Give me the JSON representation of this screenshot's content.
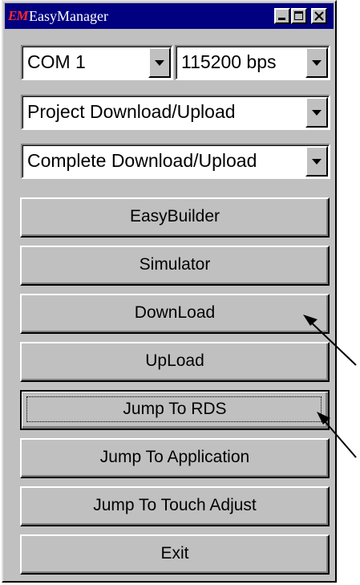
{
  "window": {
    "title": "EasyManager",
    "logo_text": "EM"
  },
  "port_select": {
    "value": "COM 1"
  },
  "baud_select": {
    "value": "115200 bps"
  },
  "mode_select": {
    "value": "Project Download/Upload"
  },
  "transfer_select": {
    "value": "Complete Download/Upload"
  },
  "buttons": {
    "easybuilder": "EasyBuilder",
    "simulator": "Simulator",
    "download": "DownLoad",
    "upload": "UpLoad",
    "jump_rds": "Jump To RDS",
    "jump_app": "Jump To Application",
    "jump_touch": "Jump To Touch Adjust",
    "exit": "Exit"
  },
  "colors": {
    "titlebar": "#000080",
    "face": "#c0c0c0",
    "logo": "#ff2a2a"
  }
}
